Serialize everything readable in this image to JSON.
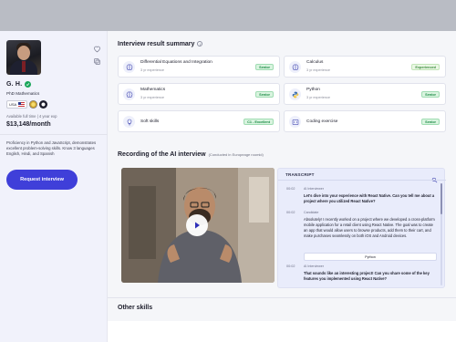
{
  "candidate": {
    "name": "G. H.",
    "degree": "PhD Mathematics",
    "country_code": "USA",
    "availability": "Available full time  |  4 year exp",
    "salary": "$13,148/month",
    "bio": "Proficiency in Python and JavaScript, demonstrates excellent problem-solving skills. Know 3 languages English, Hindi, and Spanish",
    "request_label": "Request interview"
  },
  "summary": {
    "title": "Interview result summary",
    "skills": [
      {
        "name": "Differential Equations and Integration",
        "experience": "3 yr experience",
        "rating": "Senior",
        "icon": "brain-icon"
      },
      {
        "name": "Calculus",
        "experience": "3 yr experience",
        "rating": "Experienced",
        "icon": "brain-icon"
      },
      {
        "name": "Mathematics",
        "experience": "3 yr experience",
        "rating": "Senior",
        "icon": "brain-icon"
      },
      {
        "name": "Python",
        "experience": "3 yr experience",
        "rating": "Senior",
        "icon": "python-icon"
      },
      {
        "name": "Soft skills",
        "experience": "",
        "rating": "C1 - Excellent",
        "icon": "lightbulb-icon"
      },
      {
        "name": "Coding exercise",
        "experience": "",
        "rating": "Senior",
        "icon": "code-icon"
      }
    ]
  },
  "recording": {
    "title": "Recording of the AI interview",
    "note": "(Conducted in Europeage roomid)"
  },
  "transcript": {
    "header": "TRANSCRIPT",
    "entries": [
      {
        "time": "00:02",
        "speaker": "AI Interviewer",
        "text": "Let's dive into your experience with React Native. Can you tell me about a project where you utilized React Native?"
      },
      {
        "time": "00:02",
        "speaker": "Candidate",
        "text": "Absolutely! I recently worked on a project where we developed a cross-platform mobile application for a retail client using React Native. The goal was to create an app that would allow users to browse products, add them to their cart, and make purchases seamlessly on both iOS and Android devices."
      },
      {
        "time": "00:02",
        "speaker": "AI Interviewer",
        "text": "That sounds like an interesting project! Can you share some of the key features you implemented using React Native?"
      }
    ],
    "chip_label": "Python"
  },
  "other_skills": {
    "title": "Other skills"
  },
  "colors": {
    "primary": "#3f3fd9",
    "sidebar_bg": "#f1f2fb",
    "transcript_bg": "#e9ecfb",
    "senior_tag": "#d9f4df"
  }
}
